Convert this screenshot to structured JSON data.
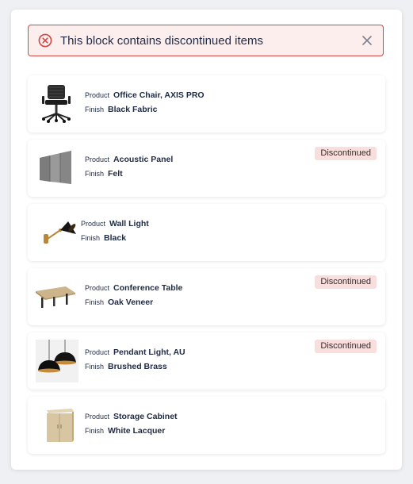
{
  "alert": {
    "message": "This block contains discontinued items",
    "icon": "error-circle-icon",
    "color": "#d64545"
  },
  "labels": {
    "product": "Product",
    "finish": "Finish"
  },
  "items": [
    {
      "product": "Office Chair, AXIS PRO",
      "finish": "Black Fabric",
      "badge": "",
      "thumb": "office-chair-thumbnail"
    },
    {
      "product": "Acoustic Panel",
      "finish": "Felt",
      "badge": "Discontinued",
      "thumb": "acoustic-panel-thumbnail"
    },
    {
      "product": "Wall Light",
      "finish": "Black",
      "badge": "",
      "thumb": "wall-light-thumbnail"
    },
    {
      "product": "Conference Table",
      "finish": "Oak Veneer",
      "badge": "Discontinued",
      "thumb": "conference-table-thumbnail"
    },
    {
      "product": "Pendant Light, AU",
      "finish": "Brushed Brass",
      "badge": "Discontinued",
      "thumb": "pendant-light-thumbnail"
    },
    {
      "product": "Storage Cabinet",
      "finish": "White Lacquer",
      "badge": "",
      "thumb": "storage-cabinet-thumbnail"
    }
  ]
}
